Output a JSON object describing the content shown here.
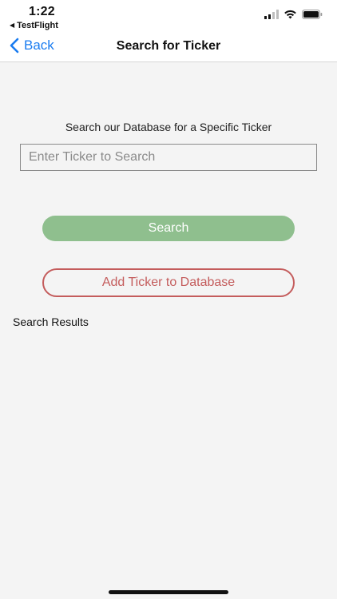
{
  "status_bar": {
    "time": "1:22",
    "back_app": "TestFlight",
    "icons": [
      "cellular-signal-icon",
      "wifi-icon",
      "battery-icon"
    ]
  },
  "nav": {
    "back_label": "Back",
    "title": "Search for Ticker",
    "accent_color": "#1a7cf0"
  },
  "search": {
    "prompt": "Search our Database for a Specific Ticker",
    "input_value": "",
    "placeholder": "Enter Ticker to Search",
    "button_label": "Search",
    "button_color": "#8fbf8e"
  },
  "add": {
    "button_label": "Add Ticker to Database",
    "button_color": "#c45c5c"
  },
  "results": {
    "label": "Search Results"
  }
}
